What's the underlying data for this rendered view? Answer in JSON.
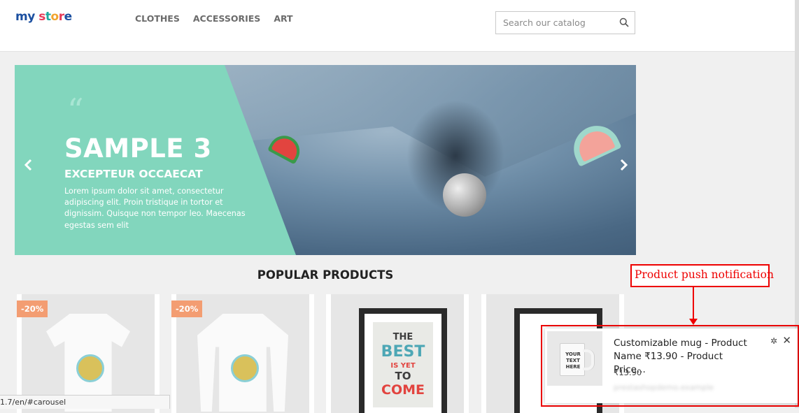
{
  "header": {
    "logo": [
      "m",
      "y",
      " ",
      "s",
      "t",
      "o",
      "r",
      "e"
    ],
    "nav": [
      {
        "label": "CLOTHES"
      },
      {
        "label": "ACCESSORIES"
      },
      {
        "label": "ART"
      }
    ],
    "search": {
      "placeholder": "Search our catalog",
      "icon": "search-icon"
    }
  },
  "carousel": {
    "quote_mark": "“",
    "title": "SAMPLE 3",
    "subtitle": "EXCEPTEUR OCCAECAT",
    "description": "Lorem ipsum dolor sit amet, consectetur adipiscing elit. Proin tristique in tortor et dignissim. Quisque non tempor leo. Maecenas egestas sem elit",
    "prev": "‹",
    "next": "›",
    "background_color": "#82d6bd"
  },
  "section": {
    "title": "POPULAR PRODUCTS"
  },
  "products": [
    {
      "discount": "-20%"
    },
    {
      "discount": "-20%"
    },
    {
      "art_text": [
        "THE",
        "BEST",
        "IS YET",
        "TO",
        "COME"
      ]
    },
    {}
  ],
  "annotation": {
    "label": "Product push notification",
    "color": "#ee0000"
  },
  "notification": {
    "title": "Customizable mug - Product Name ₹13.90 - Product Price...",
    "price": "₹13.90",
    "site": "prestashopdemo.example",
    "thumb_text": "YOUR TEXT HERE",
    "gear": "✲",
    "close": "✕"
  },
  "status_bar": {
    "url": "1.7/en/#carousel"
  }
}
